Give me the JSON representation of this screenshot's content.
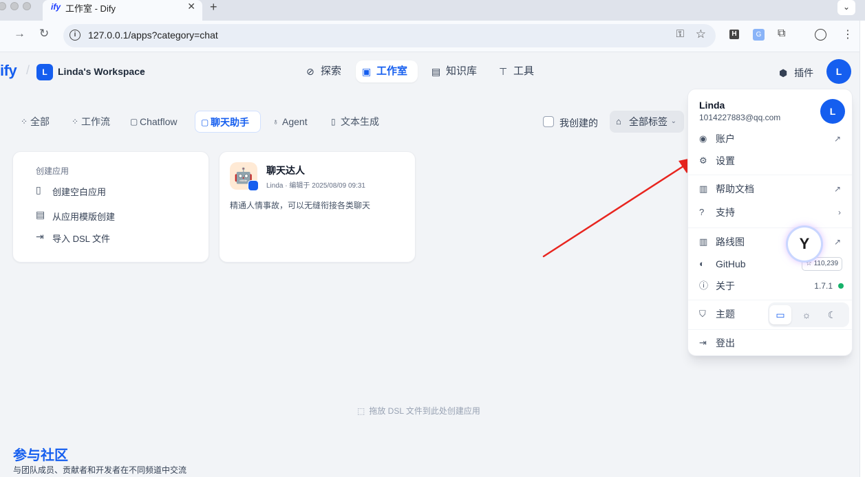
{
  "browser": {
    "tab_title": "工作室 - Dify",
    "tab_favicon": "ify",
    "url": "127.0.0.1/apps?category=chat"
  },
  "header": {
    "logo_suffix": "ify",
    "workspace_initial": "L",
    "workspace_name": "Linda's Workspace",
    "nav": [
      {
        "label": "探索",
        "icon": "compass-icon"
      },
      {
        "label": "工作室",
        "icon": "robot-icon"
      },
      {
        "label": "知识库",
        "icon": "book-icon"
      },
      {
        "label": "工具",
        "icon": "hammer-icon"
      }
    ],
    "active_nav": "工作室",
    "plugins_label": "插件",
    "avatar_initial": "L"
  },
  "filters": {
    "tabs": [
      {
        "label": "全部"
      },
      {
        "label": "工作流"
      },
      {
        "label": "Chatflow"
      },
      {
        "label": "聊天助手"
      },
      {
        "label": "Agent"
      },
      {
        "label": "文本生成"
      }
    ],
    "active_tab": "聊天助手",
    "mine_label": "我创建的",
    "mine_checked": false,
    "tags_label": "全部标签"
  },
  "create_card": {
    "title": "创建应用",
    "items": [
      {
        "label": "创建空白应用"
      },
      {
        "label": "从应用模版创建"
      },
      {
        "label": "导入 DSL 文件"
      }
    ]
  },
  "app_card": {
    "name": "聊天达人",
    "meta": "Linda · 编辑于 2025/08/09 09:31",
    "description": "精通人情事故，可以无缝衔接各类聊天"
  },
  "dropzone_text": "拖放 DSL 文件到此处创建应用",
  "community": {
    "title": "参与社区",
    "subtitle": "与团队成员、贡献者和开发者在不同频道中交流"
  },
  "menu": {
    "user_name": "Linda",
    "email": "1014227883@qq.com",
    "avatar_initial": "L",
    "account": "账户",
    "settings": "设置",
    "help_docs": "帮助文档",
    "support": "支持",
    "roadmap": "路线图",
    "github": "GitHub",
    "github_stars": "110,239",
    "about": "关于",
    "version": "1.7.1",
    "theme": "主题",
    "logout": "登出"
  },
  "colors": {
    "accent": "#155eef",
    "arrow": "#e8251f",
    "status_ok": "#17b26a"
  }
}
